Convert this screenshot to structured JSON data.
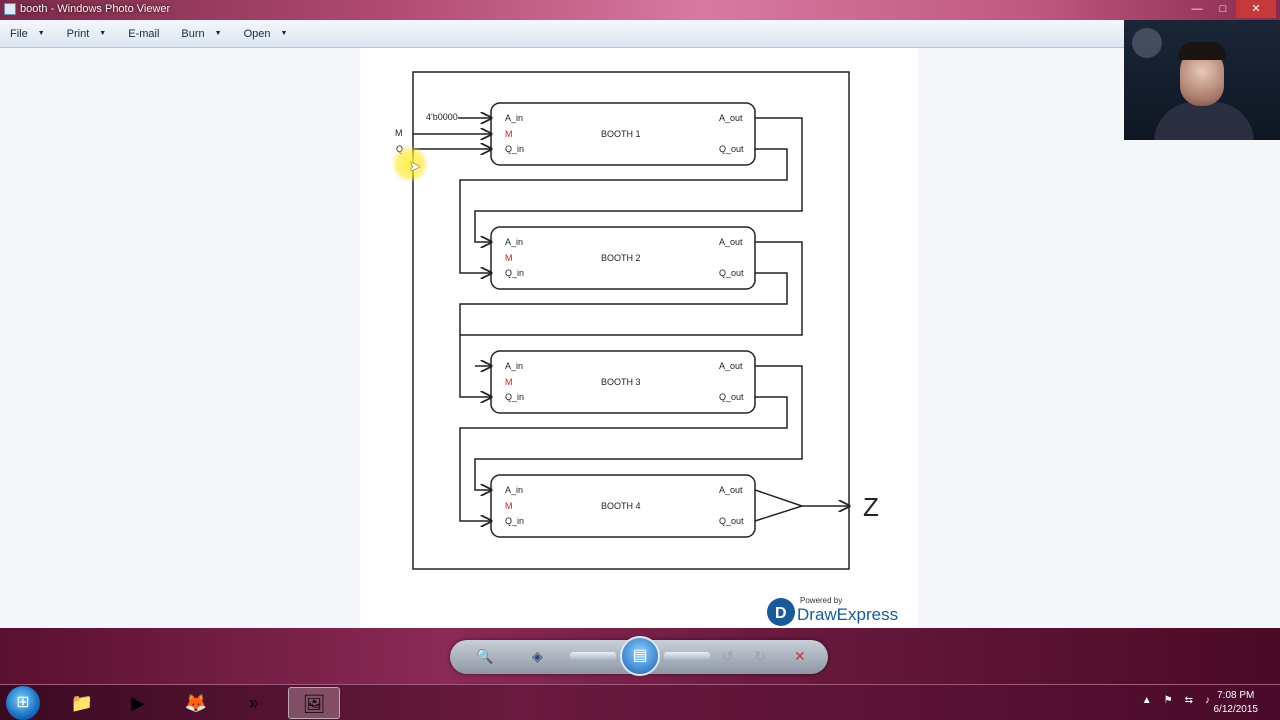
{
  "window": {
    "title": "booth - Windows Photo Viewer",
    "minimize": "—",
    "maximize": "□",
    "close": "✕"
  },
  "menu": [
    {
      "label": "File"
    },
    {
      "label": "Print"
    },
    {
      "label": "E-mail"
    },
    {
      "label": "Burn"
    },
    {
      "label": "Open"
    }
  ],
  "diagram": {
    "init_label": "4'b0000",
    "input_m": "M",
    "input_q": "Q",
    "output_label": "Z",
    "blocks": [
      {
        "name": "BOOTH 1",
        "a_in": "A_in",
        "m": "M",
        "q_in": "Q_in",
        "a_out": "A_out",
        "q_out": "Q_out"
      },
      {
        "name": "BOOTH 2",
        "a_in": "A_in",
        "m": "M",
        "q_in": "Q_in",
        "a_out": "A_out",
        "q_out": "Q_out"
      },
      {
        "name": "BOOTH 3",
        "a_in": "A_in",
        "m": "M",
        "q_in": "Q_in",
        "a_out": "A_out",
        "q_out": "Q_out"
      },
      {
        "name": "BOOTH 4",
        "a_in": "A_in",
        "m": "M",
        "q_in": "Q_in",
        "a_out": "A_out",
        "q_out": "Q_out"
      }
    ],
    "watermark_top": "Powered by",
    "watermark_brand": "DrawExpress"
  },
  "colors": {
    "line": "#222222",
    "m_port": "#cc2222",
    "brand": "#1a5a9a"
  },
  "taskbar": {
    "clock_time": "7:08 PM",
    "clock_date": "6/12/2015"
  }
}
